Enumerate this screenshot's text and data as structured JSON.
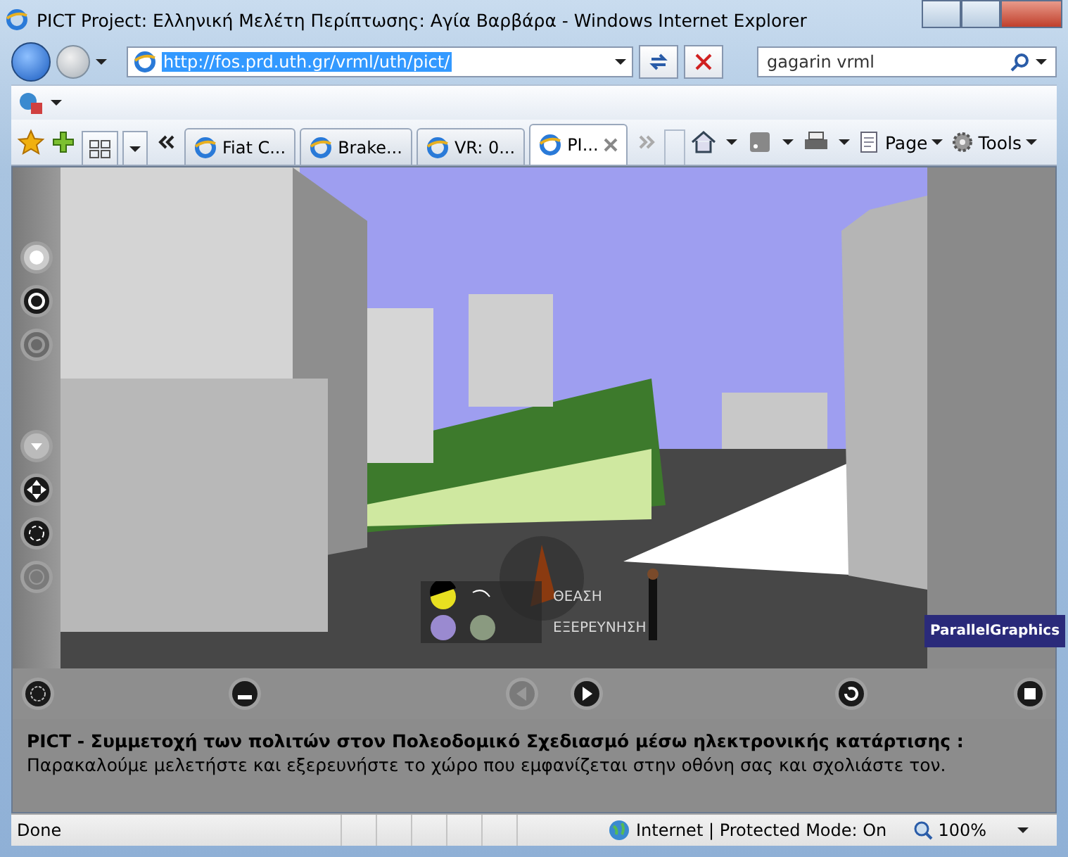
{
  "window": {
    "title": "PICT Project: Ελληνική Μελέτη Περίπτωσης: Αγία Βαρβάρα - Windows Internet Explorer"
  },
  "address_bar": {
    "value": "http://fos.prd.uth.gr/vrml/uth/pict/"
  },
  "search": {
    "value": "gagarin vrml"
  },
  "tabs": [
    {
      "label": "Fiat C...",
      "selected": false
    },
    {
      "label": "Brake...",
      "selected": false
    },
    {
      "label": "VR: 0...",
      "selected": false
    },
    {
      "label": "PI...",
      "selected": true
    }
  ],
  "command_bar": [
    {
      "label": "Page"
    },
    {
      "label": "Tools"
    }
  ],
  "viewer": {
    "hud_labels": [
      "ΘΕΑΣΗ",
      "ΕΞΕΡΕΥΝΗΣΗ"
    ],
    "logo": "ParallelGraphics"
  },
  "description": {
    "heading": "PICT - Συμμετοχή των πολιτών στον Πολεοδομικό Σχεδιασμό μέσω ηλεκτρονικής κατάρτισης :",
    "text": "Παρακαλούμε μελετήστε και εξερευνήστε το χώρο που εμφανίζεται στην οθόνη σας και σχολιάστε τον."
  },
  "status_bar": {
    "status": "Done",
    "zone": "Internet | Protected Mode: On",
    "zoom": "100%"
  }
}
